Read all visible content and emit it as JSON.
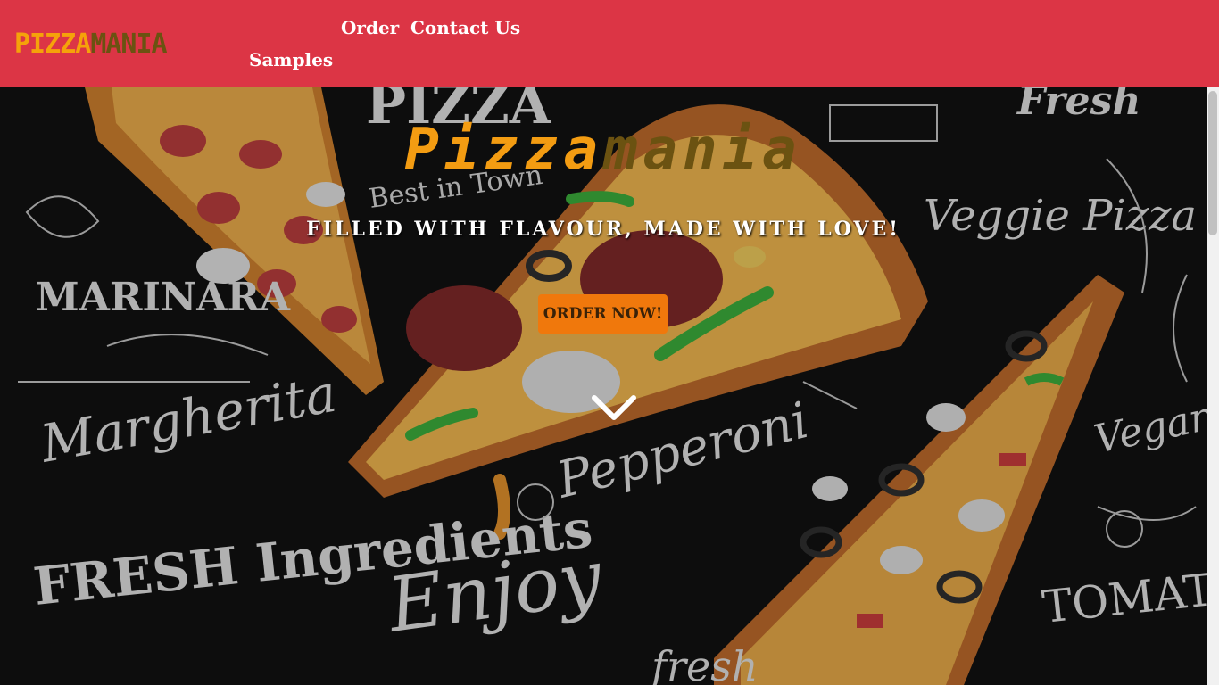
{
  "navbar": {
    "brand_part1": "PIZZA",
    "brand_part2": "MANIA",
    "links": [
      "Order",
      "Contact Us",
      "Samples"
    ]
  },
  "hero": {
    "title_part1": "Pizza",
    "title_part2": "mania",
    "tagline": "FILLED WITH FLAVOUR, MADE WITH LOVE!",
    "cta_label": "ORDER NOW!"
  },
  "background_text": [
    "PIZZA",
    "Fresh",
    "Best in Town",
    "Veggie Pizza",
    "MARINARA",
    "Margherita",
    "Pepperoni",
    "Vegan",
    "FRESH Ingredients",
    "Enjoy",
    "fresh",
    "TOMATO"
  ],
  "colors": {
    "navbar": "#dc3545",
    "brand_orange": "#f5a20a",
    "brand_brown": "#6b5211",
    "cta": "#f0780c"
  },
  "icons": {
    "scroll_down": "chevron-down-icon"
  }
}
